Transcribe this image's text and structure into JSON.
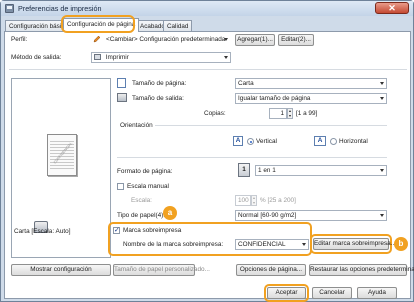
{
  "window": {
    "title": "Preferencias de impresión",
    "close_label": "✕"
  },
  "tabs": [
    "Configuración básica",
    "Configuración de página",
    "Acabado",
    "Calidad"
  ],
  "profile": {
    "label": "Perfil:",
    "value": "<Cambiar> Configuración predeterminada",
    "add_label": "Agregar(1)...",
    "edit_label": "Editar(2)..."
  },
  "output": {
    "label": "Método de salida:",
    "value": "Imprimir"
  },
  "preview": {
    "watermark": "CONFIDENCIAL",
    "caption": "Carta [Escala: Auto]",
    "show_settings_label": "Mostrar configuración"
  },
  "page_size": {
    "label": "Tamaño de página:",
    "value": "Carta"
  },
  "output_size": {
    "label": "Tamaño de salida:",
    "value": "Igualar tamaño de página"
  },
  "copies": {
    "label": "Copias:",
    "value": "1",
    "range": "[1 a 99]"
  },
  "orientation": {
    "label": "Orientación",
    "vertical_label": "Vertical",
    "horizontal_label": "Horizontal",
    "selected": "Vertical",
    "icon_letter": "A"
  },
  "page_layout": {
    "label": "Formato de página:",
    "value": "1 en 1",
    "icon_number": "1"
  },
  "manual_scaling": {
    "label": "Escala manual",
    "scale_label": "Escala:",
    "scale_value": "100",
    "scale_range": "% [25 a 200]"
  },
  "paper_type": {
    "label": "Tipo de papel(4):",
    "value": "Normal [60-90 g/m2]"
  },
  "watermark": {
    "checkbox_label": "Marca sobreimpresa",
    "checked": true,
    "name_label": "Nombre de la marca sobreimpresa:",
    "name_value": "CONFIDENCIAL",
    "edit_label": "Editar marca sobreimpresa..."
  },
  "bottom_buttons": {
    "custom_paper": "Tamaño de papel personalizado...",
    "page_options": "Opciones de página...",
    "restore": "Restaurar las opciones predeterminadas"
  },
  "dialog_buttons": {
    "ok": "Aceptar",
    "cancel": "Cancelar",
    "help": "Ayuda"
  },
  "callouts": {
    "a": "a",
    "b": "b"
  },
  "colors": {
    "accent": "#f1a121",
    "title_bar": "#c3d4e8",
    "close": "#c44a33"
  }
}
